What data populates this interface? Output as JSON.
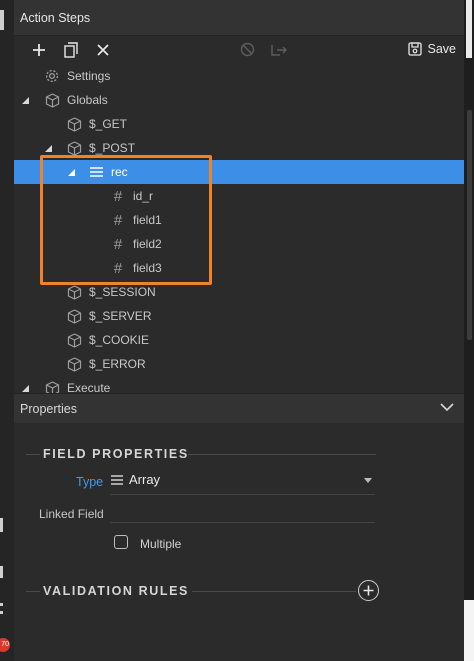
{
  "panel": {
    "title": "Action Steps"
  },
  "toolbar": {
    "save_label": "Save"
  },
  "tree": {
    "settings": "Settings",
    "globals": "Globals",
    "get": "$_GET",
    "post": "$_POST",
    "rec": "rec",
    "id_r": "id_r",
    "field1": "field1",
    "field2": "field2",
    "field3": "field3",
    "session": "$_SESSION",
    "server": "$_SERVER",
    "cookie": "$_COOKIE",
    "error": "$_ERROR",
    "execute": "Execute"
  },
  "properties": {
    "title": "Properties",
    "field_properties": "FIELD PROPERTIES",
    "type_label": "Type",
    "type_value": "Array",
    "linked_field_label": "Linked Field",
    "linked_field_value": "",
    "multiple_label": "Multiple",
    "validation_rules": "VALIDATION RULES"
  },
  "badge": {
    "text": "70"
  },
  "colors": {
    "selection": "#3d8ee6",
    "highlight": "#f0832a",
    "type_label": "#3d9bf0"
  }
}
